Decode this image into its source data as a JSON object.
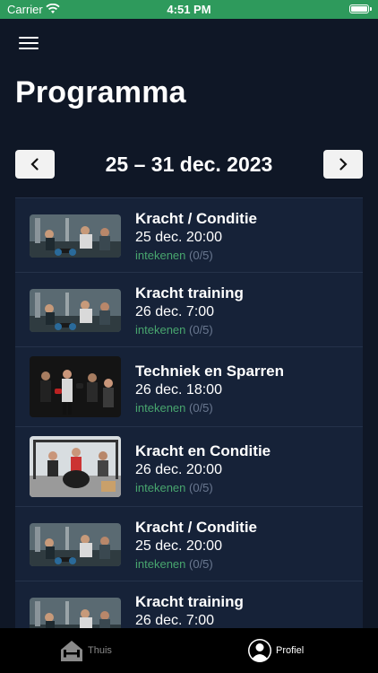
{
  "status": {
    "carrier": "Carrier",
    "time": "4:51 PM"
  },
  "title": "Programma",
  "week": {
    "label": "25 – 31 dec. 2023"
  },
  "items": [
    {
      "title": "Kracht / Conditie",
      "date": "25 dec. 20:00",
      "signup": "intekenen",
      "count": "(0/5)"
    },
    {
      "title": "Kracht training",
      "date": "26 dec. 7:00",
      "signup": "intekenen",
      "count": "(0/5)"
    },
    {
      "title": "Techniek en Sparren",
      "date": "26 dec. 18:00",
      "signup": "intekenen",
      "count": "(0/5)"
    },
    {
      "title": "Kracht en Conditie",
      "date": "26 dec. 20:00",
      "signup": "intekenen",
      "count": "(0/5)"
    },
    {
      "title": "Kracht / Conditie",
      "date": "25 dec. 20:00",
      "signup": "intekenen",
      "count": "(0/5)"
    },
    {
      "title": "Kracht training",
      "date": "26 dec. 7:00",
      "signup": "",
      "count": ""
    }
  ],
  "tabs": {
    "home": "Thuis",
    "profile": "Profiel"
  },
  "colors": {
    "statusbar": "#2e9a5c",
    "background": "#0f1726",
    "card": "#162238",
    "accent": "#48a56e"
  }
}
